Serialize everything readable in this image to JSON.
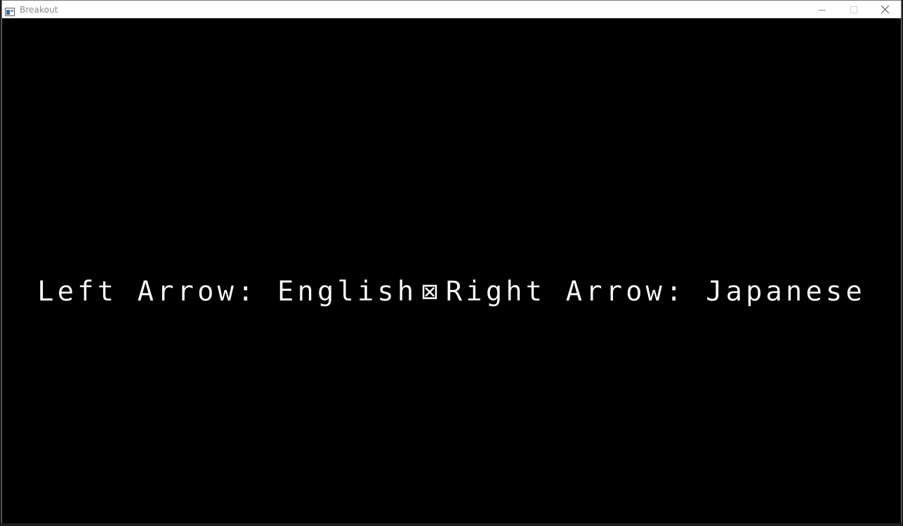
{
  "window": {
    "title": "Breakout",
    "controls": {
      "minimize": "minimize-icon",
      "maximize": "maximize-icon",
      "close": "close-icon"
    }
  },
  "game": {
    "background": "#000000",
    "text_color": "#ffffff",
    "prompt_left": "Left Arrow: English",
    "separator": "⊠",
    "prompt_right": "Right Arrow: Japanese"
  }
}
